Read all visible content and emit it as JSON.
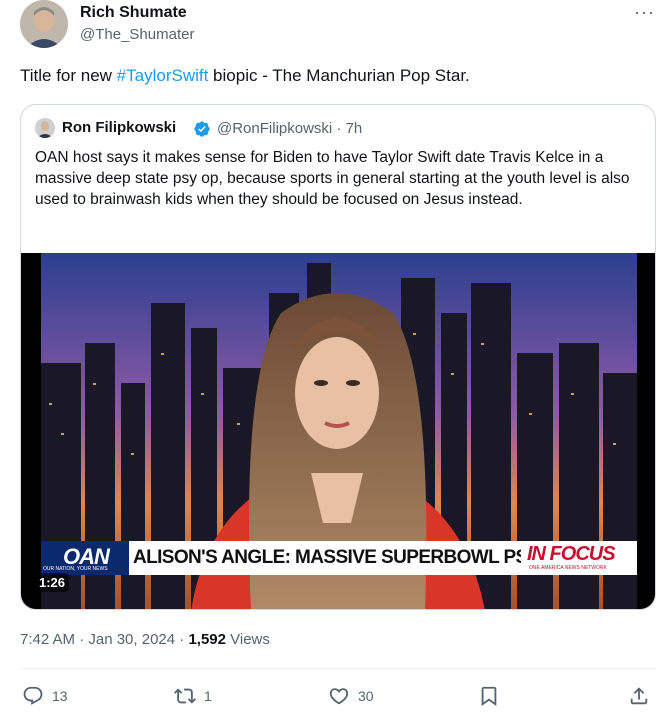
{
  "tweet": {
    "author_name": "Rich Shumate",
    "author_handle": "@The_Shumater",
    "text_before": "Title for new ",
    "hashtag": "#TaylorSwift",
    "text_after": " biopic - The Manchurian Pop Star.",
    "more_label": "···"
  },
  "quote": {
    "author_name": "Ron Filipkowski",
    "author_handle": "@RonFilipkowski · 7h",
    "text": "OAN host says it makes sense for Biden to have Taylor Swift date Travis Kelce in a massive deep state psy op, because sports in general starting at the youth level is also used to brainwash kids when they should be focused on Jesus instead.",
    "video": {
      "duration": "1:26",
      "network_logo": "OAN",
      "network_tagline": "OUR NATION, YOUR NEWS",
      "chyron": "ALISON'S ANGLE: MASSIVE SUPERBOWL PSY-OP",
      "segment_logo": "IN FOCUS",
      "segment_sub": "ONE AMERICA NEWS NETWORK"
    }
  },
  "meta": {
    "time": "7:42 AM · Jan 30, 2024 · ",
    "views_count": "1,592",
    "views_label": " Views"
  },
  "actions": {
    "replies": "13",
    "retweets": "1",
    "likes": "30"
  },
  "colors": {
    "accent": "#1d9bf0",
    "muted": "#536471",
    "oan_blue": "#0b2a6e",
    "focus_red": "#c8102e"
  }
}
